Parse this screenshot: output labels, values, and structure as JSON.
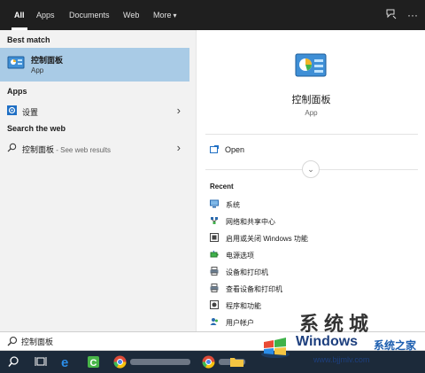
{
  "tabs": [
    {
      "label": "All",
      "active": true
    },
    {
      "label": "Apps",
      "active": false
    },
    {
      "label": "Documents",
      "active": false
    },
    {
      "label": "Web",
      "active": false
    },
    {
      "label": "More",
      "active": false
    }
  ],
  "top_icons": [
    "feedback-icon",
    "more-options-icon"
  ],
  "more_options_glyph": "···",
  "left": {
    "best_match_header": "Best match",
    "best_match": {
      "title": "控制面板",
      "subtitle": "App",
      "icon": "control-panel-icon"
    },
    "apps_header": "Apps",
    "apps": [
      {
        "label": "设置",
        "icon": "gear-icon"
      }
    ],
    "web_header": "Search the web",
    "web": {
      "query": "控制面板",
      "suffix": " - See web results",
      "icon": "search-icon"
    }
  },
  "right": {
    "app_title": "控制面板",
    "app_subtitle": "App",
    "open_label": "Open",
    "recent_header": "Recent",
    "recent": [
      {
        "label": "系统",
        "icon": "monitor-icon"
      },
      {
        "label": "网络和共享中心",
        "icon": "network-icon"
      },
      {
        "label": "启用或关闭 Windows 功能",
        "icon": "windows-features-icon"
      },
      {
        "label": "电源选项",
        "icon": "power-options-icon"
      },
      {
        "label": "设备和打印机",
        "icon": "printer-icon"
      },
      {
        "label": "查看设备和打印机",
        "icon": "printer-icon"
      },
      {
        "label": "程序和功能",
        "icon": "programs-icon"
      },
      {
        "label": "用户帐户",
        "icon": "user-accounts-icon"
      }
    ]
  },
  "search": {
    "value": "控制面板"
  },
  "taskbar": {
    "items": [
      "start-icon",
      "task-view-icon",
      "edge-icon",
      "camtasia-icon",
      "chrome-icon",
      "chrome-icon",
      "file-explorer-icon"
    ]
  },
  "watermark": {
    "brand": "Windows",
    "brand_cn": "系统之家",
    "url": "www.bjjmlv.com",
    "overlay_text": "系统城"
  },
  "colors": {
    "accent_blue": "#a9cbe6",
    "topbar": "#1f1f1f",
    "taskbar": "#1c2a3a",
    "pane_bg": "#f2f2f2"
  }
}
